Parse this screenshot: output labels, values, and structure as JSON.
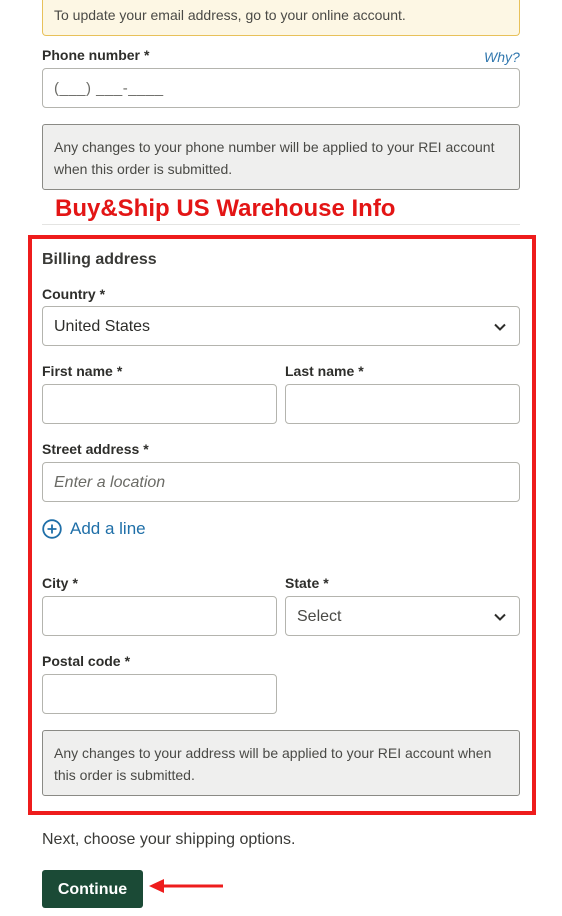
{
  "top_notice": "To update your email address, go to your online account.",
  "phone": {
    "label": "Phone number",
    "required": "*",
    "why_link": "Why?",
    "placeholder": "(___) ___-____",
    "note": "Any changes to your phone number will be applied to your REI account when this order is submitted."
  },
  "annotation": {
    "title": "Buy&Ship US Warehouse Info",
    "color": "#e31515"
  },
  "billing": {
    "title": "Billing address",
    "country": {
      "label": "Country",
      "required": "*",
      "value": "United States"
    },
    "first_name": {
      "label": "First name",
      "required": "*",
      "value": ""
    },
    "last_name": {
      "label": "Last name",
      "required": "*",
      "value": ""
    },
    "street": {
      "label": "Street address",
      "required": "*",
      "placeholder": "Enter a location"
    },
    "add_line": "Add a line",
    "city": {
      "label": "City",
      "required": "*",
      "value": ""
    },
    "state": {
      "label": "State",
      "required": "*",
      "value": "Select"
    },
    "postal": {
      "label": "Postal code",
      "required": "*",
      "value": ""
    },
    "note": "Any changes to your address will be applied to your REI account when this order is submitted."
  },
  "next_text": "Next, choose your shipping options.",
  "continue_label": "Continue",
  "colors": {
    "primary_button": "#1b4a36",
    "link": "#1f6fa8",
    "annotation_red": "#ee1c1c"
  }
}
